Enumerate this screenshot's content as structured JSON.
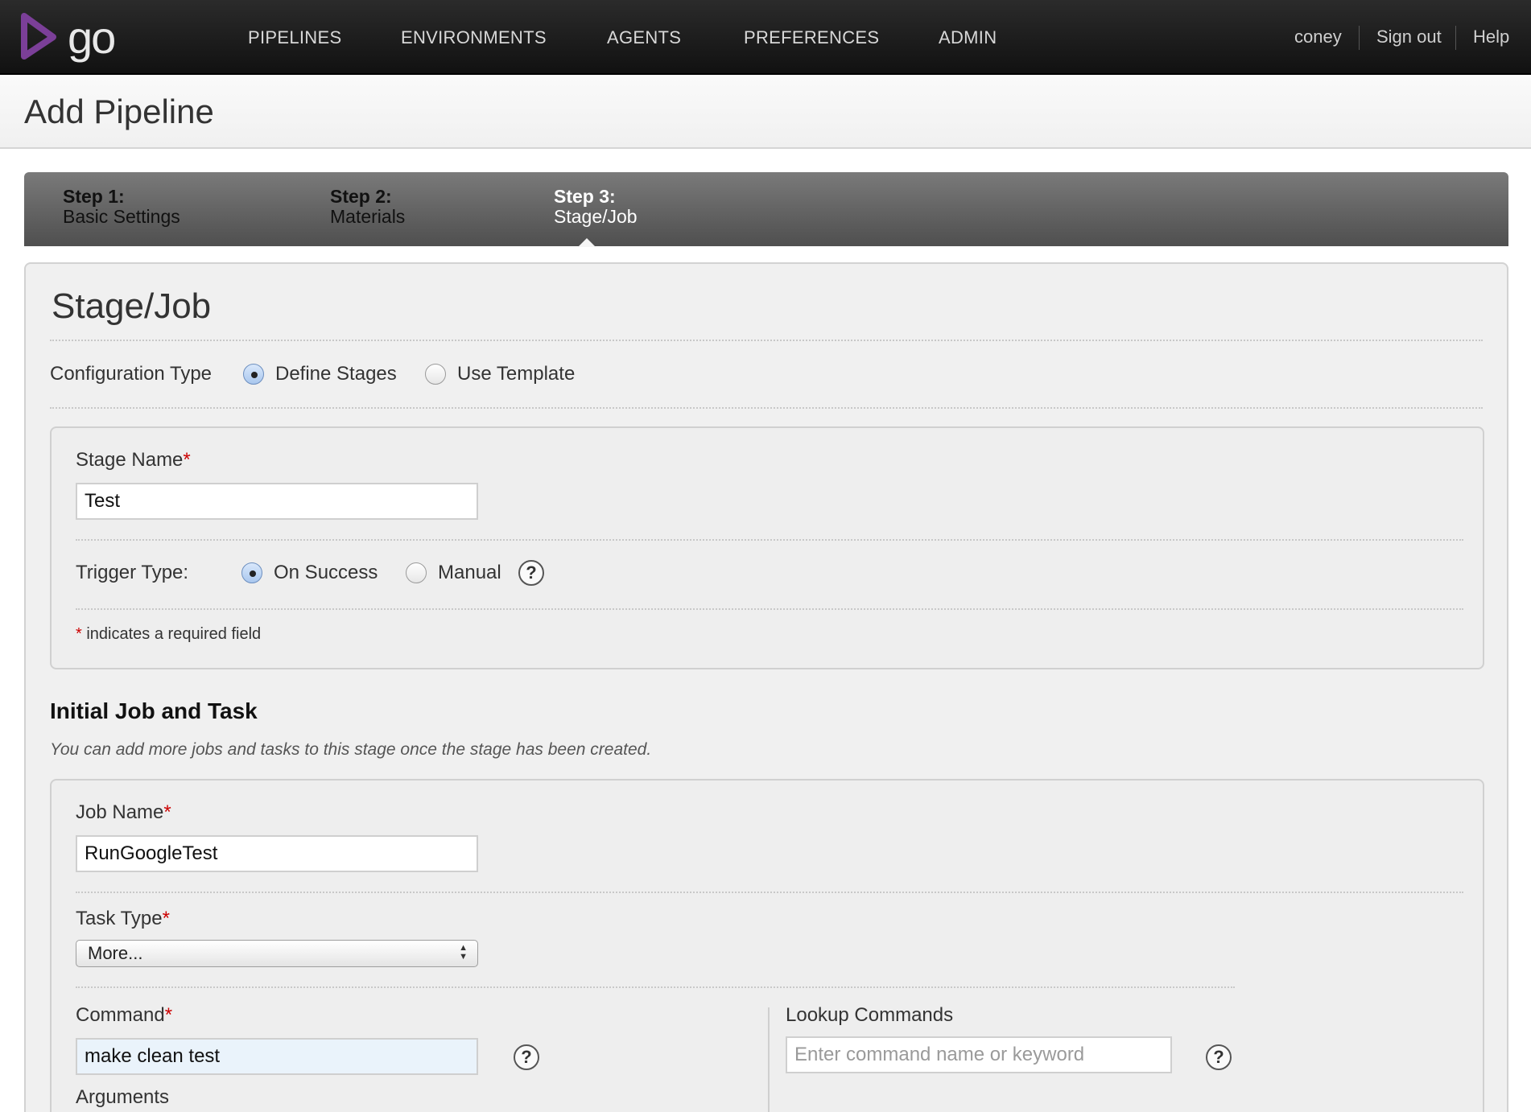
{
  "brand": {
    "name": "go",
    "logo_color": "#7b3f98"
  },
  "nav": {
    "items": [
      "PIPELINES",
      "ENVIRONMENTS",
      "AGENTS",
      "PREFERENCES",
      "ADMIN"
    ],
    "user": "coney",
    "sign_out": "Sign out",
    "help": "Help"
  },
  "page": {
    "title": "Add Pipeline"
  },
  "steps": [
    {
      "num": "Step 1:",
      "label": "Basic Settings",
      "active": false
    },
    {
      "num": "Step 2:",
      "label": "Materials",
      "active": false
    },
    {
      "num": "Step 3:",
      "label": "Stage/Job",
      "active": true
    }
  ],
  "stage_job": {
    "title": "Stage/Job",
    "config_type": {
      "label": "Configuration Type",
      "options": [
        "Define Stages",
        "Use Template"
      ],
      "selected": "Define Stages"
    },
    "stage": {
      "name_label": "Stage Name",
      "required_mark": "*",
      "name_value": "Test",
      "trigger_label": "Trigger Type:",
      "trigger_options": [
        "On Success",
        "Manual"
      ],
      "trigger_selected": "On Success",
      "help_glyph": "?",
      "required_note": "indicates a required field"
    },
    "initial": {
      "heading": "Initial Job and Task",
      "note": "You can add more jobs and tasks to this stage once the stage has been created.",
      "job_name_label": "Job Name",
      "job_name_value": "RunGoogleTest",
      "task_type_label": "Task Type",
      "task_type_value": "More...",
      "command_label": "Command",
      "command_value": "make clean test",
      "arguments_label": "Arguments",
      "lookup_label": "Lookup Commands",
      "lookup_placeholder": "Enter command name or keyword"
    }
  }
}
